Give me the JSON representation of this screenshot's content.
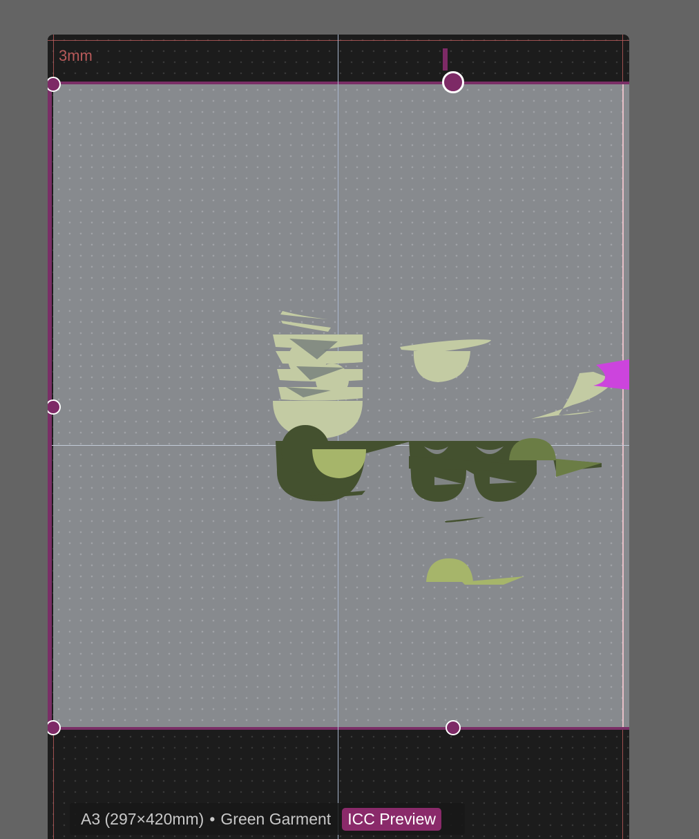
{
  "canvas": {
    "bleed_label": "3mm",
    "colors": {
      "selection": "#7d2a66",
      "bleed": "#b85a5a",
      "page": "#878a8e",
      "artwork_light": "#c3cba3",
      "artwork_dark": "#44512f",
      "artwork_mid": "#a6b56a",
      "artwork_olive": "#6b7d45",
      "artwork_accent": "#cc44dd"
    }
  },
  "status_bar": {
    "size_label": "A3 (297×420mm)",
    "separator": "•",
    "profile_label": "Green Garment",
    "icc_badge": "ICC Preview"
  }
}
